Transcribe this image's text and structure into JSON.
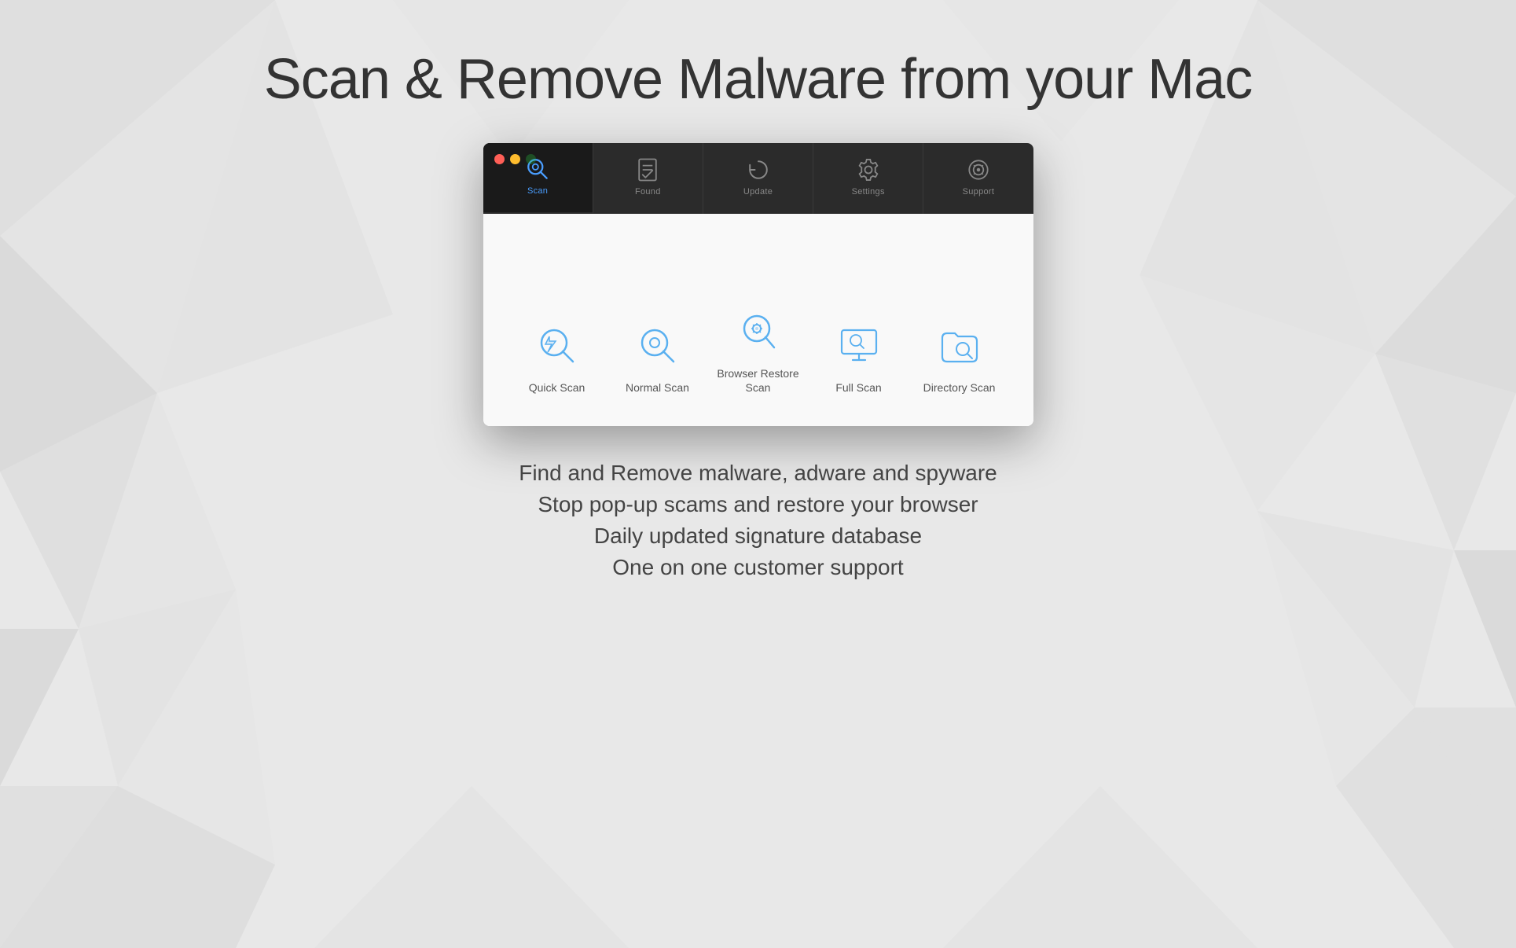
{
  "page": {
    "headline": "Scan & Remove Malware from your Mac",
    "features": [
      "Find and Remove malware, adware and spyware",
      "Stop pop-up scams and restore your browser",
      "Daily updated signature database",
      "One on one customer support"
    ]
  },
  "app": {
    "tabs": [
      {
        "id": "scan",
        "label": "Scan",
        "active": true
      },
      {
        "id": "found",
        "label": "Found",
        "active": false
      },
      {
        "id": "update",
        "label": "Update",
        "active": false
      },
      {
        "id": "settings",
        "label": "Settings",
        "active": false
      },
      {
        "id": "support",
        "label": "Support",
        "active": false
      }
    ],
    "scan_options": [
      {
        "id": "quick-scan",
        "label": "Quick\nScan"
      },
      {
        "id": "normal-scan",
        "label": "Normal\nScan"
      },
      {
        "id": "browser-restore-scan",
        "label": "Browser Restore\nScan"
      },
      {
        "id": "full-scan",
        "label": "Full\nScan"
      },
      {
        "id": "directory-scan",
        "label": "Directory\nScan"
      }
    ]
  },
  "colors": {
    "accent_blue": "#4a9eff",
    "icon_blue": "#5ab0f0",
    "toolbar_bg": "#2b2b2b",
    "toolbar_active": "#1a1a1a",
    "content_bg": "#f9f9f9"
  }
}
